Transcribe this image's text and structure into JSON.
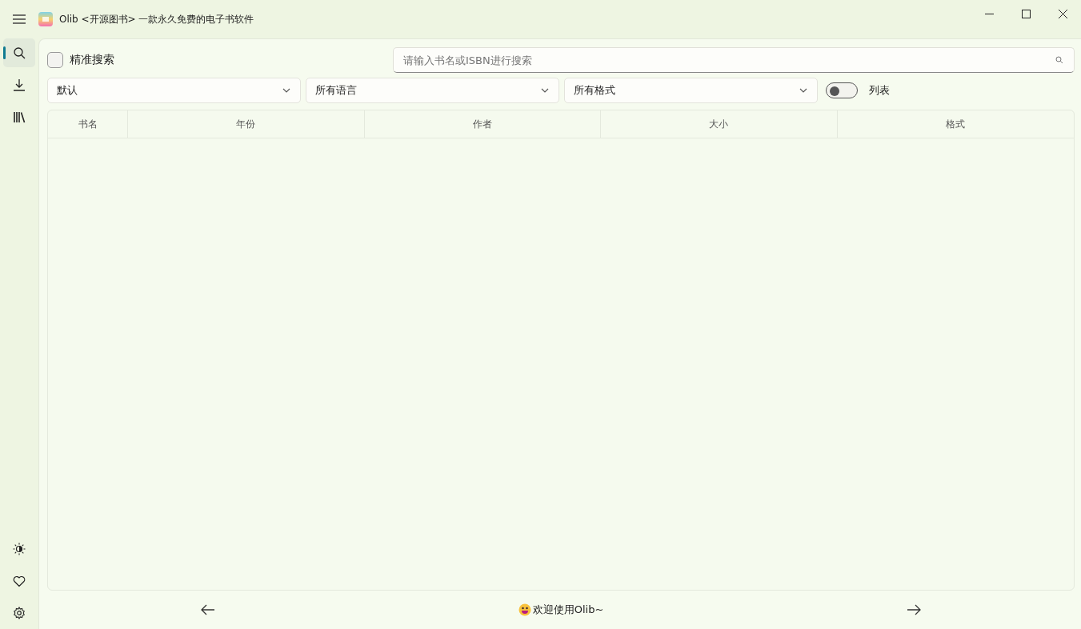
{
  "window": {
    "title": "Olib <开源图书> 一款永久免费的电子书软件"
  },
  "sidebar": {
    "items": [
      {
        "kind": "search",
        "selected": true
      },
      {
        "kind": "download",
        "selected": false
      },
      {
        "kind": "library",
        "selected": false
      }
    ],
    "bottom_items": [
      {
        "kind": "theme",
        "selected": false
      },
      {
        "kind": "heart",
        "selected": false
      },
      {
        "kind": "settings",
        "selected": false
      }
    ]
  },
  "exact_search": {
    "label": "精准搜索",
    "checked": false
  },
  "search": {
    "placeholder": "请输入书名或ISBN进行搜索"
  },
  "filters": [
    {
      "value": "默认"
    },
    {
      "value": "所有语言"
    },
    {
      "value": "所有格式"
    }
  ],
  "list_toggle": {
    "label": "列表",
    "on": false
  },
  "table": {
    "columns": [
      "书名",
      "年份",
      "作者",
      "大小",
      "格式"
    ]
  },
  "footer": {
    "message": "欢迎使用Olib~"
  }
}
